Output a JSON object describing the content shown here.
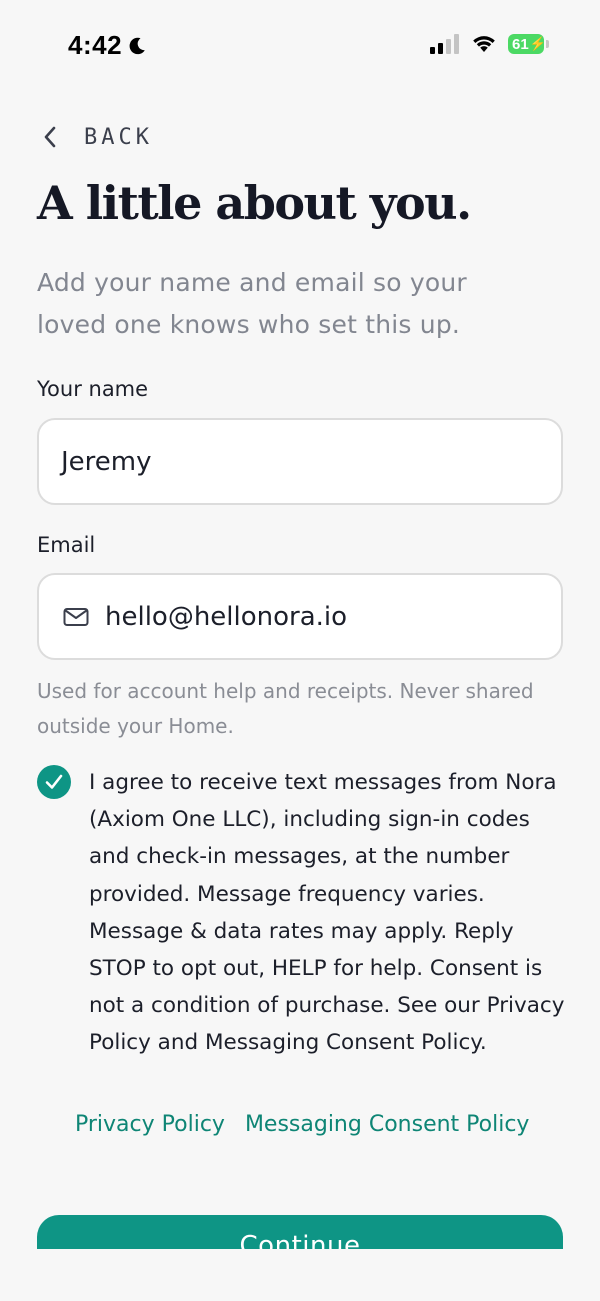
{
  "status_bar": {
    "time": "4:42",
    "battery": "61"
  },
  "nav": {
    "back_label": "BACK"
  },
  "header": {
    "title": "A little about you.",
    "subtitle": "Add your name and email so your loved one knows who set this up."
  },
  "form": {
    "name_label": "Your name",
    "name_value": "Jeremy",
    "email_label": "Email",
    "email_value": "hello@hellonora.io",
    "email_helper": "Used for account help and receipts. Never shared outside your Home."
  },
  "consent": {
    "checked": true,
    "text": "I agree to receive text messages from Nora (Axiom One LLC), including sign-in codes and check-in messages, at the number provided. Message frequency varies. Message & data rates may apply. Reply STOP to opt out, HELP for help. Consent is not a condition of purchase. See our Privacy Policy and Messaging Consent Policy.",
    "links": [
      "Privacy Policy",
      "Messaging Consent Policy"
    ]
  },
  "actions": {
    "continue_label": "Continue"
  },
  "colors": {
    "accent": "#0e9585",
    "link": "#0e8575",
    "battery": "#4cd964"
  },
  "icons": {
    "back": "chevron-left-icon",
    "mail": "mail-icon",
    "check": "checkmark-icon",
    "moon": "moon-icon",
    "signal": "cellular-signal-icon",
    "wifi": "wifi-icon",
    "battery": "battery-icon"
  }
}
